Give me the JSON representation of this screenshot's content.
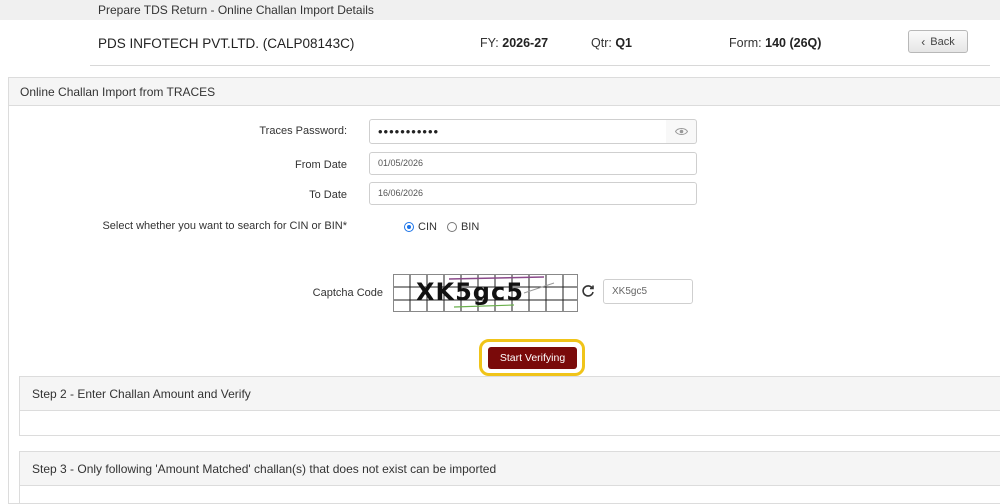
{
  "page": {
    "title": "Prepare TDS Return - Online Challan Import Details"
  },
  "header": {
    "company": "PDS INFOTECH PVT.LTD. (CALP08143C)",
    "fy_label": "FY:",
    "fy_value": "2026-27",
    "qtr_label": "Qtr:",
    "qtr_value": "Q1",
    "form_label": "Form:",
    "form_value": "140 (26Q)",
    "back_label": "Back"
  },
  "panel": {
    "title": "Online Challan Import from TRACES"
  },
  "form": {
    "traces_password_label": "Traces Password:",
    "traces_password_value": "•••••••••••",
    "from_date_label": "From Date",
    "from_date_value": "01/05/2026",
    "to_date_label": "To Date",
    "to_date_value": "16/06/2026",
    "search_type_label": "Select whether you want to search for CIN or BIN*",
    "search_options": [
      "CIN",
      "BIN"
    ],
    "selected_search": "CIN",
    "captcha_label": "Captcha Code",
    "captcha_image_text": "XK5gc5",
    "captcha_value": "XK5gc5",
    "verify_button": "Start Verifying"
  },
  "steps": [
    {
      "title": "Step 2 - Enter Challan Amount and Verify"
    },
    {
      "title": "Step 3 - Only following 'Amount Matched' challan(s) that does not exist can be imported"
    }
  ],
  "colors": {
    "verify_button": "#7a0a0a",
    "highlight_ring": "#f0c419",
    "radio_accent": "#1a73e8"
  }
}
